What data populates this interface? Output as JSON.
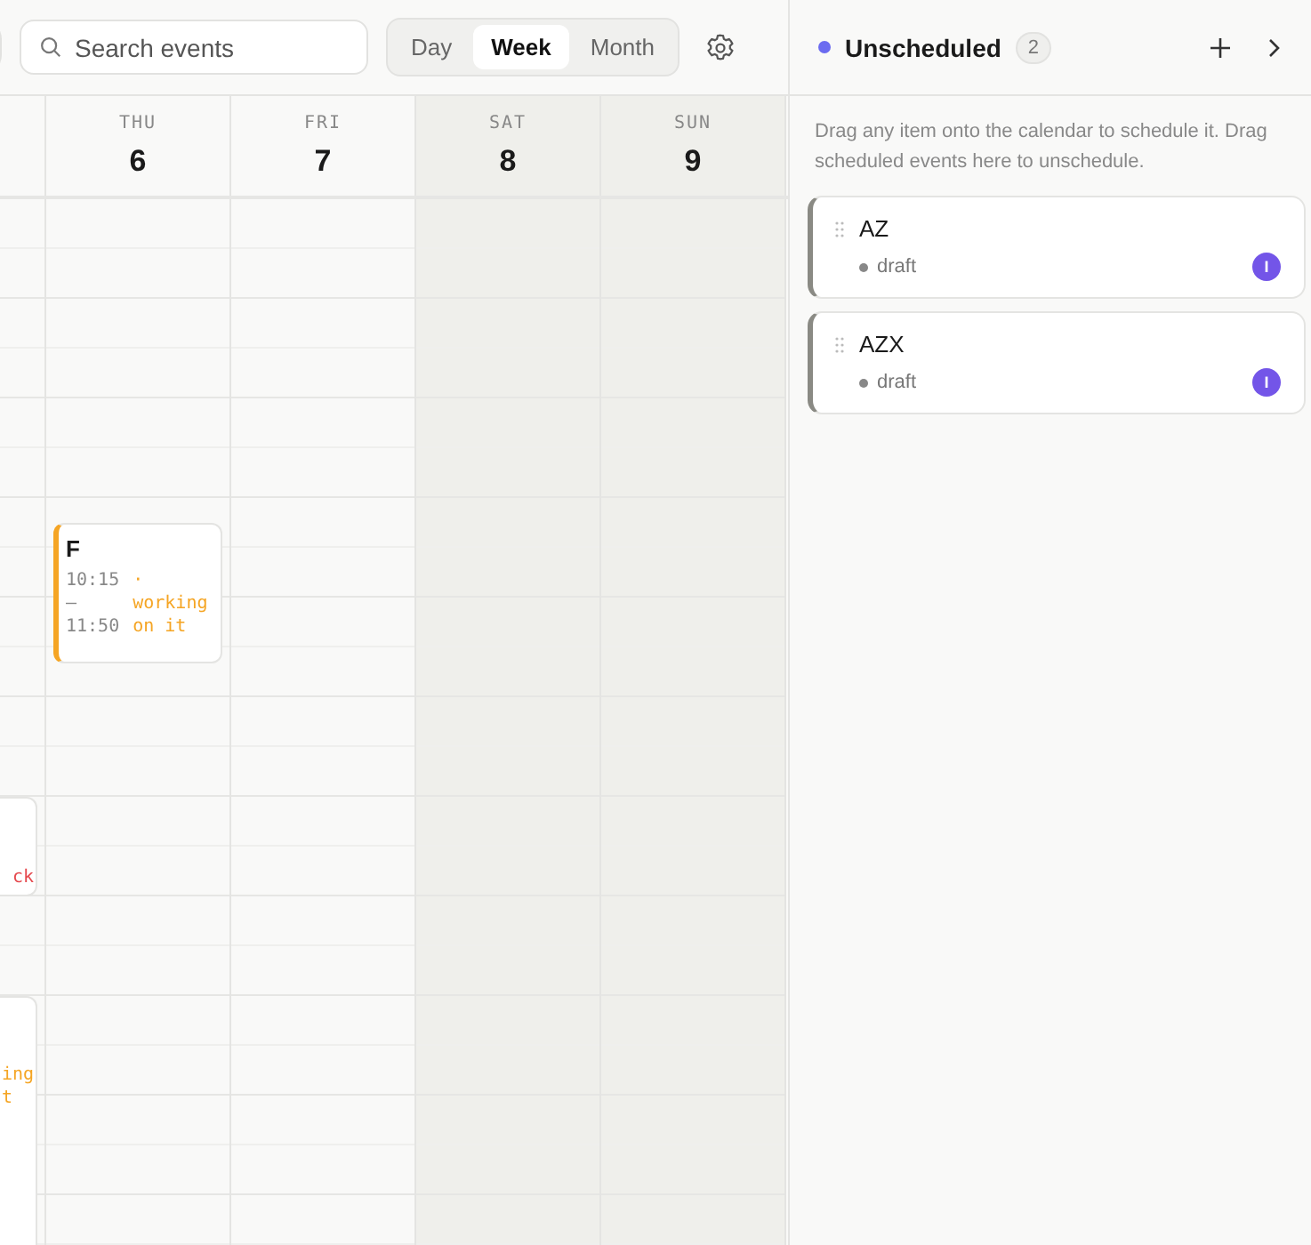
{
  "toolbar": {
    "search": {
      "placeholder": "Search events"
    },
    "views": [
      {
        "label": "Day",
        "selected": false
      },
      {
        "label": "Week",
        "selected": true
      },
      {
        "label": "Month",
        "selected": false
      }
    ]
  },
  "days": [
    {
      "weekday": "THU",
      "date": "6",
      "weekend": false,
      "events": [
        {
          "title": "F",
          "time": "10:15 – 11:50",
          "status": "· working on it",
          "color": "#f5a524"
        }
      ]
    },
    {
      "weekday": "FRI",
      "date": "7",
      "weekend": false
    },
    {
      "weekday": "SAT",
      "date": "8",
      "weekend": true
    },
    {
      "weekday": "SUN",
      "date": "9",
      "weekend": true
    }
  ],
  "partial_events": [
    {
      "status": "ck",
      "color": "#e5484d"
    },
    {
      "status": "ing\nt",
      "color": "#f5a524"
    }
  ],
  "panel": {
    "title": "Unscheduled",
    "count": "2",
    "hint": "Drag any item onto the calendar to schedule it. Drag scheduled events here to unschedule.",
    "items": [
      {
        "title": "AZ",
        "status": "draft",
        "assignee": "I"
      },
      {
        "title": "AZX",
        "status": "draft",
        "assignee": "I"
      }
    ]
  }
}
